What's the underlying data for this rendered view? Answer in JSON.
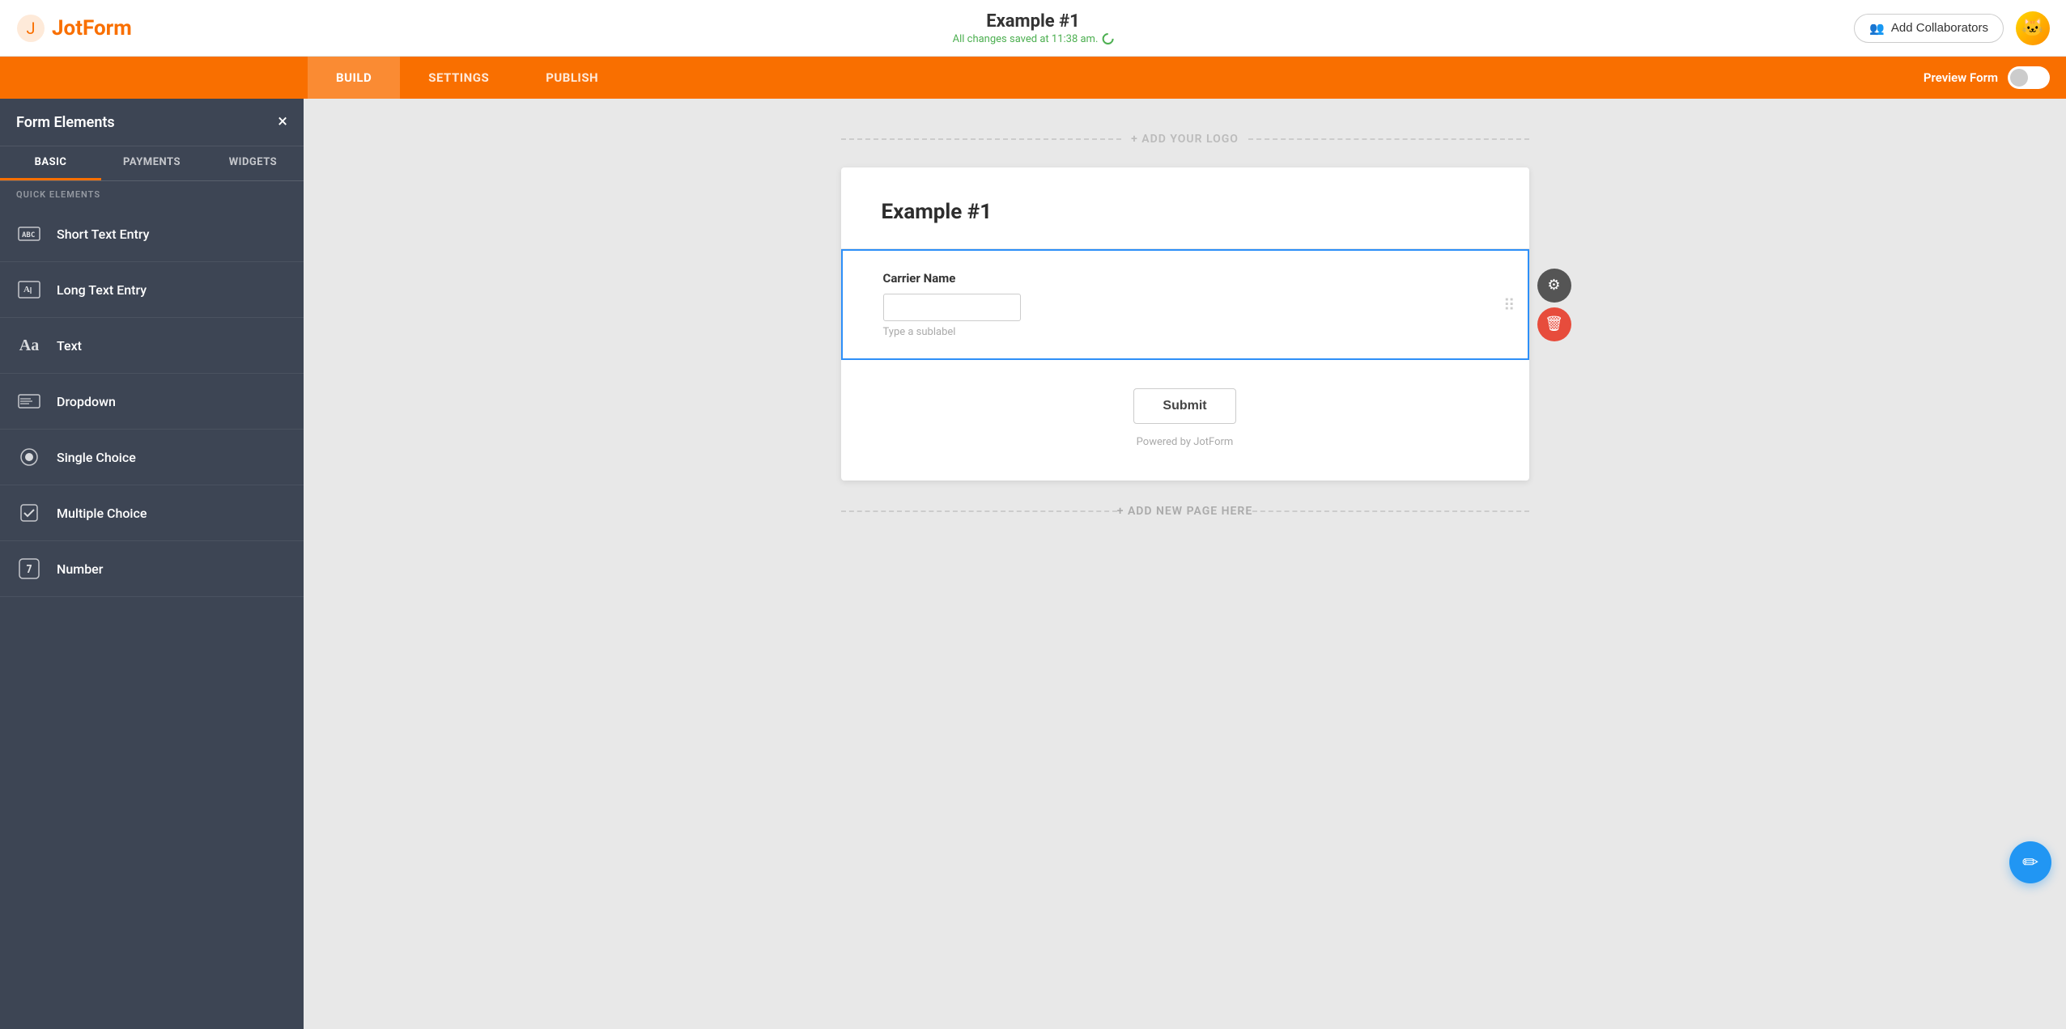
{
  "header": {
    "logo_text": "JotForm",
    "form_title": "Example #1",
    "save_status": "All changes saved at 11:38 am.",
    "add_collaborators_label": "Add Collaborators",
    "avatar_emoji": "🐱"
  },
  "nav": {
    "tabs": [
      "BUILD",
      "SETTINGS",
      "PUBLISH"
    ],
    "active_tab": "BUILD",
    "preview_label": "Preview Form"
  },
  "sidebar": {
    "title": "Form Elements",
    "close_label": "×",
    "tabs": [
      "BASIC",
      "PAYMENTS",
      "WIDGETS"
    ],
    "active_tab": "BASIC",
    "quick_elements_label": "QUICK ELEMENTS",
    "items": [
      {
        "id": "short-text",
        "label": "Short Text Entry",
        "icon": "ABC"
      },
      {
        "id": "long-text",
        "label": "Long Text Entry",
        "icon": "A|"
      },
      {
        "id": "text",
        "label": "Text",
        "icon": "Aa"
      },
      {
        "id": "dropdown",
        "label": "Dropdown",
        "icon": "≡"
      },
      {
        "id": "single-choice",
        "label": "Single Choice",
        "icon": "◎"
      },
      {
        "id": "multiple-choice",
        "label": "Multiple Choice",
        "icon": "☑"
      },
      {
        "id": "number",
        "label": "Number",
        "icon": "7"
      }
    ]
  },
  "canvas": {
    "add_logo_label": "+ ADD YOUR LOGO",
    "add_page_label": "+ ADD NEW PAGE HERE",
    "form": {
      "title": "Example #1",
      "fields": [
        {
          "id": "carrier-name",
          "label": "Carrier Name",
          "type": "short-text",
          "sublabel": "Type a sublabel",
          "active": true
        }
      ],
      "submit_label": "Submit",
      "powered_by": "Powered by JotForm"
    }
  },
  "icons": {
    "settings_icon": "⚙",
    "delete_icon": "🗑",
    "edit_icon": "✏",
    "drag_dots": "⠿",
    "collaborator_icon": "👥"
  }
}
